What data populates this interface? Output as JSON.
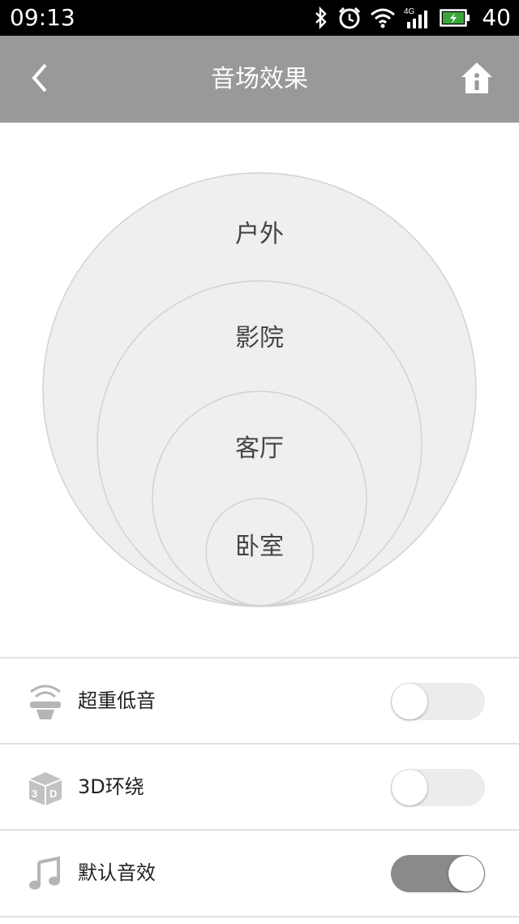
{
  "status_bar": {
    "time": "09:13",
    "battery": "40",
    "network": "4G"
  },
  "header": {
    "title": "音场效果"
  },
  "scenes": [
    {
      "label": "户外"
    },
    {
      "label": "影院"
    },
    {
      "label": "客厅"
    },
    {
      "label": "卧室"
    }
  ],
  "settings": [
    {
      "label": "超重低音",
      "icon": "subwoofer-icon",
      "enabled": false
    },
    {
      "label": "3D环绕",
      "icon": "3d-cube-icon",
      "enabled": false
    },
    {
      "label": "默认音效",
      "icon": "music-note-icon",
      "enabled": true
    }
  ],
  "colors": {
    "app_bar": "#999999",
    "toggle_on": "#8a8a8a",
    "toggle_off": "#ececec",
    "circle_fill": "#efefef"
  }
}
